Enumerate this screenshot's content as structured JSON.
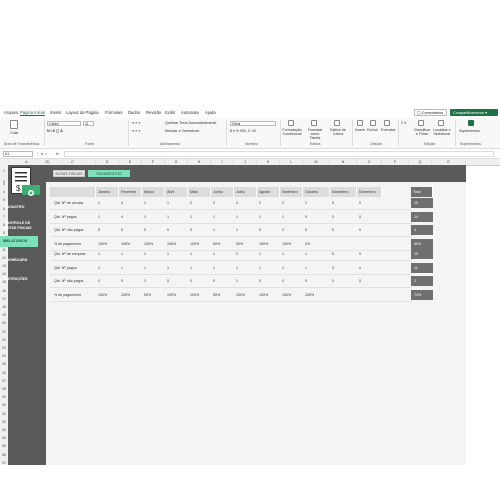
{
  "menu": {
    "items": [
      "Arquivo",
      "Página Inicial",
      "Inserir",
      "Layout da Página",
      "Fórmulas",
      "Dados",
      "Revisão",
      "Exibir",
      "Automate",
      "Ajuda"
    ],
    "comments_label": "Comentários",
    "share_label": "Compartilhamento"
  },
  "ribbon": {
    "paste_label": "Colar",
    "font_name": "Calibri",
    "font_size": "11",
    "wrap_text": "Quebrar Texto Automaticamente",
    "merge_center": "Mesclar e Centralizar",
    "number_format": "Geral",
    "cond_format": "Formatação Condicional",
    "format_table": "Formatar como Tabela",
    "cell_styles": "Estilos de Célula",
    "insert": "Inserir",
    "delete": "Excluir",
    "format": "Formatar",
    "sort_filter": "Classificar e Filtrar",
    "find_select": "Localizar e Selecionar",
    "addins": "Suplementos",
    "groups": [
      "Área de Transferência",
      "Fonte",
      "Alinhamento",
      "Número",
      "Estilos",
      "Células",
      "Edição",
      "Suplementos"
    ]
  },
  "formula_bar": {
    "name_box": "A1",
    "fx": "fx",
    "value": ""
  },
  "columns": [
    "A",
    "B",
    "C",
    "D",
    "E",
    "F",
    "G",
    "H",
    "I",
    "J",
    "K",
    "L",
    "M",
    "N",
    "O",
    "P",
    "Q",
    "R"
  ],
  "rows": [
    "1",
    "2",
    "3",
    "4",
    "5",
    "6",
    "7",
    "8",
    "9",
    "10",
    "11",
    "12",
    "13",
    "14",
    "15",
    "16",
    "17",
    "18",
    "19",
    "20",
    "21",
    "22",
    "23",
    "24",
    "25",
    "26",
    "27",
    "28",
    "29",
    "30",
    "31",
    "32",
    "33",
    "34",
    "35",
    "36",
    "37"
  ],
  "sidebar": {
    "items": [
      "CADASTRO",
      "CONTROLE DE NOTAS FISCAIS",
      "RELATÓRIOS",
      "DASHBOARD",
      "INSTRUÇÕES"
    ],
    "active_index": 2
  },
  "tabs": {
    "notas": "NOTAS FISCAIS",
    "pagamentos": "PAGAMENTOS"
  },
  "table": {
    "headers": [
      "Janeiro",
      "Fevereiro",
      "Março",
      "Abril",
      "Maio",
      "Junho",
      "Julho",
      "Agosto",
      "Setembro",
      "Outubro",
      "Novembro",
      "Dezembro",
      "Total"
    ],
    "section1": [
      {
        "label": "Qtd. Nº de vendas",
        "values": [
          "1",
          "4",
          "1",
          "1",
          "2",
          "2",
          "2",
          "2",
          "2",
          "1",
          "0",
          "0"
        ],
        "total": "19"
      },
      {
        "label": "Qtd. Nº pagos",
        "values": [
          "1",
          "4",
          "1",
          "1",
          "1",
          "1",
          "1",
          "1",
          "1",
          "0",
          "0",
          "0"
        ],
        "total": "14"
      },
      {
        "label": "Qtd. Nº não pagos",
        "values": [
          "0",
          "0",
          "0",
          "0",
          "0",
          "1",
          "1",
          "0",
          "2",
          "0",
          "0",
          "0"
        ],
        "total": "4"
      },
      {
        "label": "% de pagamento",
        "values": [
          "100%",
          "100%",
          "100%",
          "100%",
          "100%",
          "50%",
          "50%",
          "100%",
          "100%",
          "0%",
          "",
          ""
        ],
        "total": "80%"
      }
    ],
    "section2": [
      {
        "label": "Qtd. Nº de compras",
        "values": [
          "1",
          "1",
          "1",
          "1",
          "1",
          "1",
          "2",
          "1",
          "1",
          "1",
          "0",
          "0"
        ],
        "total": "13"
      },
      {
        "label": "Qtd. Nº pagos",
        "values": [
          "1",
          "1",
          "1",
          "1",
          "1",
          "1",
          "1",
          "1",
          "1",
          "1",
          "0",
          "0"
        ],
        "total": "11"
      },
      {
        "label": "Qtd. Nº não pagos",
        "values": [
          "0",
          "0",
          "1",
          "0",
          "0",
          "0",
          "1",
          "0",
          "0",
          "0",
          "0",
          "0"
        ],
        "total": "2"
      },
      {
        "label": "% de pagamento",
        "values": [
          "100%",
          "100%",
          "50%",
          "100%",
          "100%",
          "50%",
          "100%",
          "100%",
          "100%",
          "100%",
          "",
          ""
        ],
        "total": "74%"
      }
    ]
  },
  "colors": {
    "accent": "#7ee0b8",
    "sidebar": "#5a5a5a",
    "excel_green": "#1e7145"
  }
}
